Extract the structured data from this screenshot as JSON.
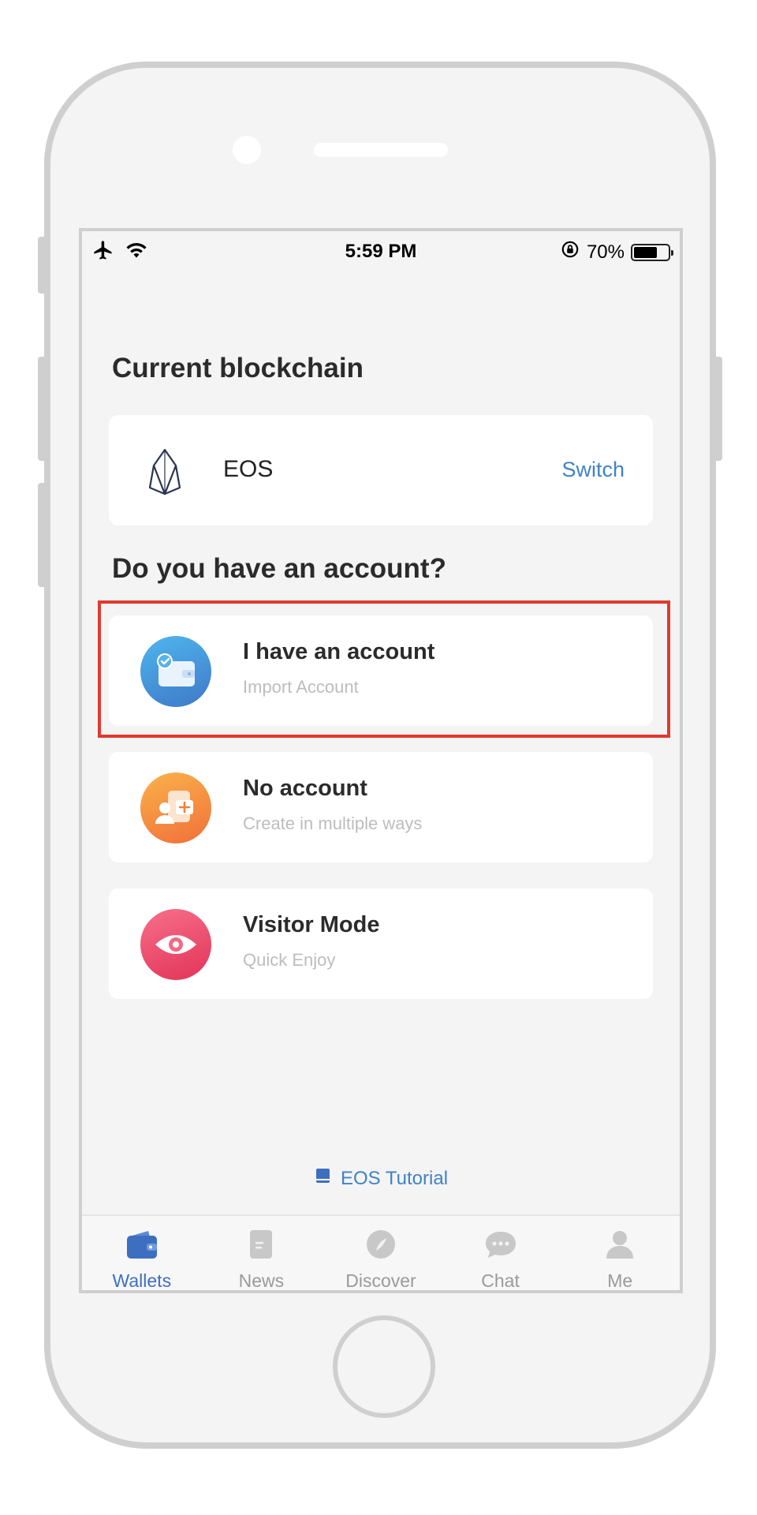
{
  "status_bar": {
    "time": "5:59 PM",
    "battery_text": "70%",
    "battery_level": 0.7
  },
  "current_chain": {
    "heading": "Current blockchain",
    "name": "EOS",
    "switch_label": "Switch"
  },
  "account_question": "Do you have an account?",
  "options": [
    {
      "title": "I have an account",
      "subtitle": "Import Account",
      "icon": "import-wallet-icon",
      "color": "#3f8fd6"
    },
    {
      "title": "No account",
      "subtitle": "Create in multiple ways",
      "icon": "create-account-icon",
      "color": "#f5893a"
    },
    {
      "title": "Visitor Mode",
      "subtitle": "Quick Enjoy",
      "icon": "eye-icon",
      "color": "#e8435f"
    }
  ],
  "tutorial_label": "EOS Tutorial",
  "tabs": [
    {
      "label": "Wallets",
      "icon": "wallet-icon",
      "active": true
    },
    {
      "label": "News",
      "icon": "news-icon",
      "active": false
    },
    {
      "label": "Discover",
      "icon": "compass-icon",
      "active": false
    },
    {
      "label": "Chat",
      "icon": "chat-icon",
      "active": false
    },
    {
      "label": "Me",
      "icon": "person-icon",
      "active": false
    }
  ],
  "colors": {
    "accent": "#3f82c6",
    "highlight": "#e03a2f",
    "background": "#f4f4f4"
  }
}
